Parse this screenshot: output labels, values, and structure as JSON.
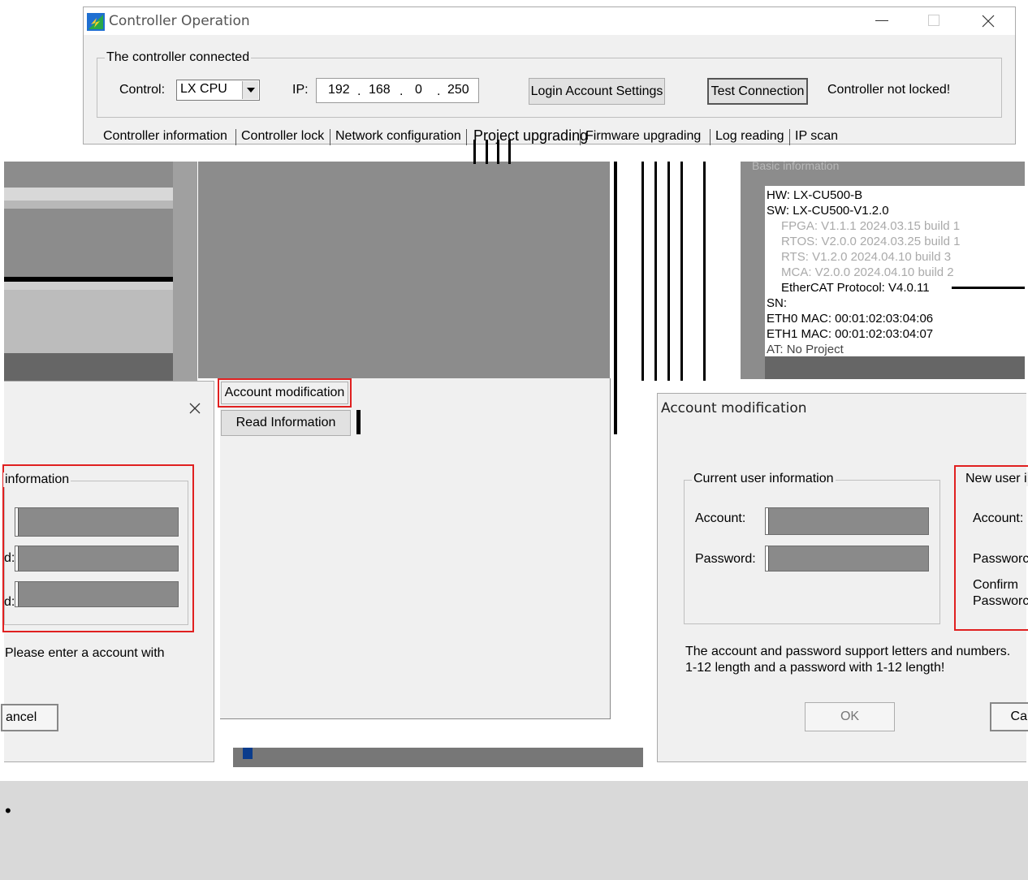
{
  "main_window": {
    "title": "Controller Operation",
    "icons": {
      "app": "app-logo-icon",
      "minimize": "minimize-icon",
      "maximize": "maximize-icon",
      "close": "close-icon"
    },
    "connected_group": "The controller connected",
    "control_label": "Control:",
    "control_value": "LX CPU",
    "ip_label": "IP:",
    "ip": [
      "192",
      "168",
      "0",
      "250"
    ],
    "login_button": "Login Account Settings",
    "test_button": "Test Connection",
    "lock_status": "Controller not locked!",
    "tabs": [
      "Controller information",
      "Controller lock",
      "Network configuration",
      "Project upgrading",
      "Firmware upgrading",
      "Log reading",
      "IP scan"
    ]
  },
  "middle_panel": {
    "account_button": "Account modification",
    "read_button": "Read Information"
  },
  "info_panel": {
    "group_label": "Basic information",
    "lines": {
      "hw": "HW: LX-CU500-B",
      "sw": "SW: LX-CU500-V1.2.0",
      "fpga": "FPGA: V1.1.1 2024.03.15 build 1",
      "rtos": "RTOS: V2.0.0 2024.03.25 build 1",
      "rts": "RTS: V1.2.0 2024.04.10 build 3",
      "mca": "MCA: V2.0.0 2024.04.10 build 2",
      "ethercat": "EtherCAT Protocol: V4.0.11",
      "sn": "SN:",
      "eth0": "ETH0 MAC: 00:01:02:03:04:06",
      "eth1": "ETH1 MAC: 00:01:02:03:04:07",
      "at": "AT: No Project"
    }
  },
  "left_dialog": {
    "close_icon": "close-icon",
    "group_label": "information",
    "row_labels": [
      "d:",
      "d:"
    ],
    "hint": "Please enter a account with",
    "cancel_button": "ancel"
  },
  "right_dialog": {
    "title": "Account modification",
    "current_group": "Current user information",
    "account_label": "Account:",
    "password_label": "Password:",
    "new_group": "New user i",
    "new_account_label": "Account:",
    "new_password_label": "Passworc",
    "confirm_label_1": "Confirm",
    "confirm_label_2": "Passworc",
    "hint_line1": "The account and password support letters and numbers.",
    "hint_line2": "1-12 length and a password with 1-12 length!",
    "ok_button": "OK",
    "cancel_button": "Ca"
  },
  "footer": {
    "bullet": "•"
  }
}
